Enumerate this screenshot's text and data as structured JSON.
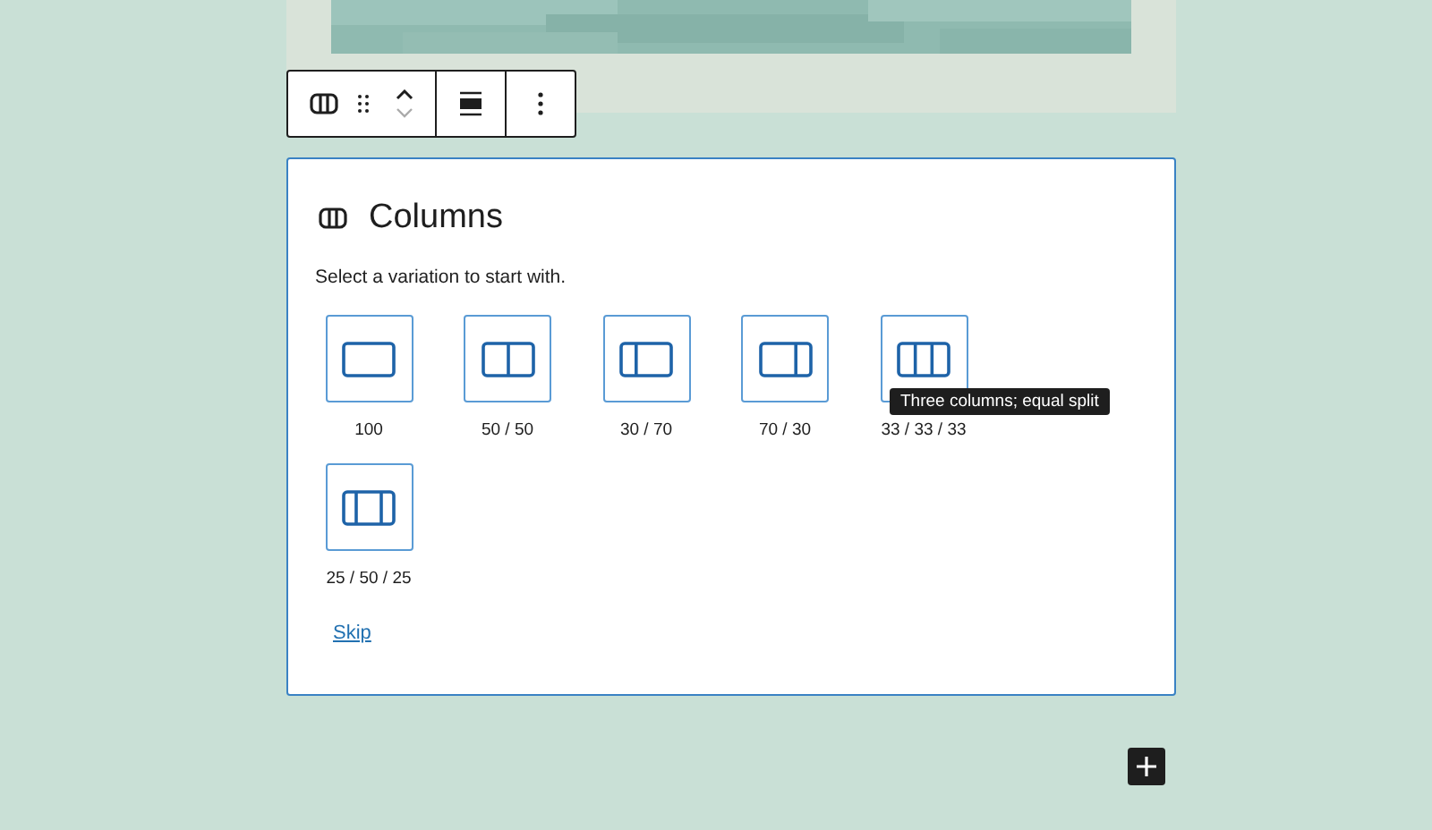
{
  "placeholder": {
    "title": "Columns",
    "instructions": "Select a variation to start with.",
    "variations": [
      {
        "label": "100",
        "kind": "single"
      },
      {
        "label": "50 / 50",
        "kind": "halves"
      },
      {
        "label": "30 / 70",
        "kind": "narrow-wide"
      },
      {
        "label": "70 / 30",
        "kind": "wide-narrow"
      },
      {
        "label": "33 / 33 / 33",
        "kind": "thirds",
        "tooltip": "Three columns; equal split"
      },
      {
        "label": "25 / 50 / 25",
        "kind": "wide-center"
      }
    ],
    "skip": "Skip"
  }
}
